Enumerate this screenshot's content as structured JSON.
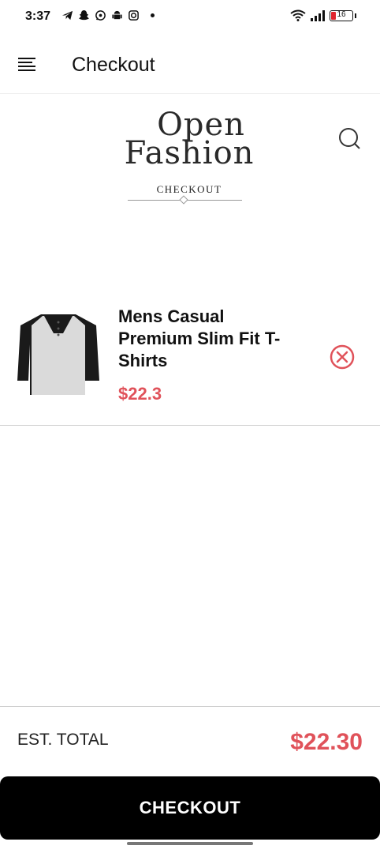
{
  "status_bar": {
    "time": "3:37",
    "battery": "16"
  },
  "header": {
    "title": "Checkout"
  },
  "brand": {
    "line1": "Open",
    "line2": "Fashion",
    "subtitle": "CHECKOUT"
  },
  "cart": {
    "items": [
      {
        "name": "Mens Casual Premium Slim Fit T-Shirts",
        "price": "$22.3"
      }
    ]
  },
  "summary": {
    "label": "EST. TOTAL",
    "total": "$22.30"
  },
  "actions": {
    "checkout_label": "CHECKOUT"
  },
  "colors": {
    "accent": "#e0525a",
    "button": "#000000"
  }
}
